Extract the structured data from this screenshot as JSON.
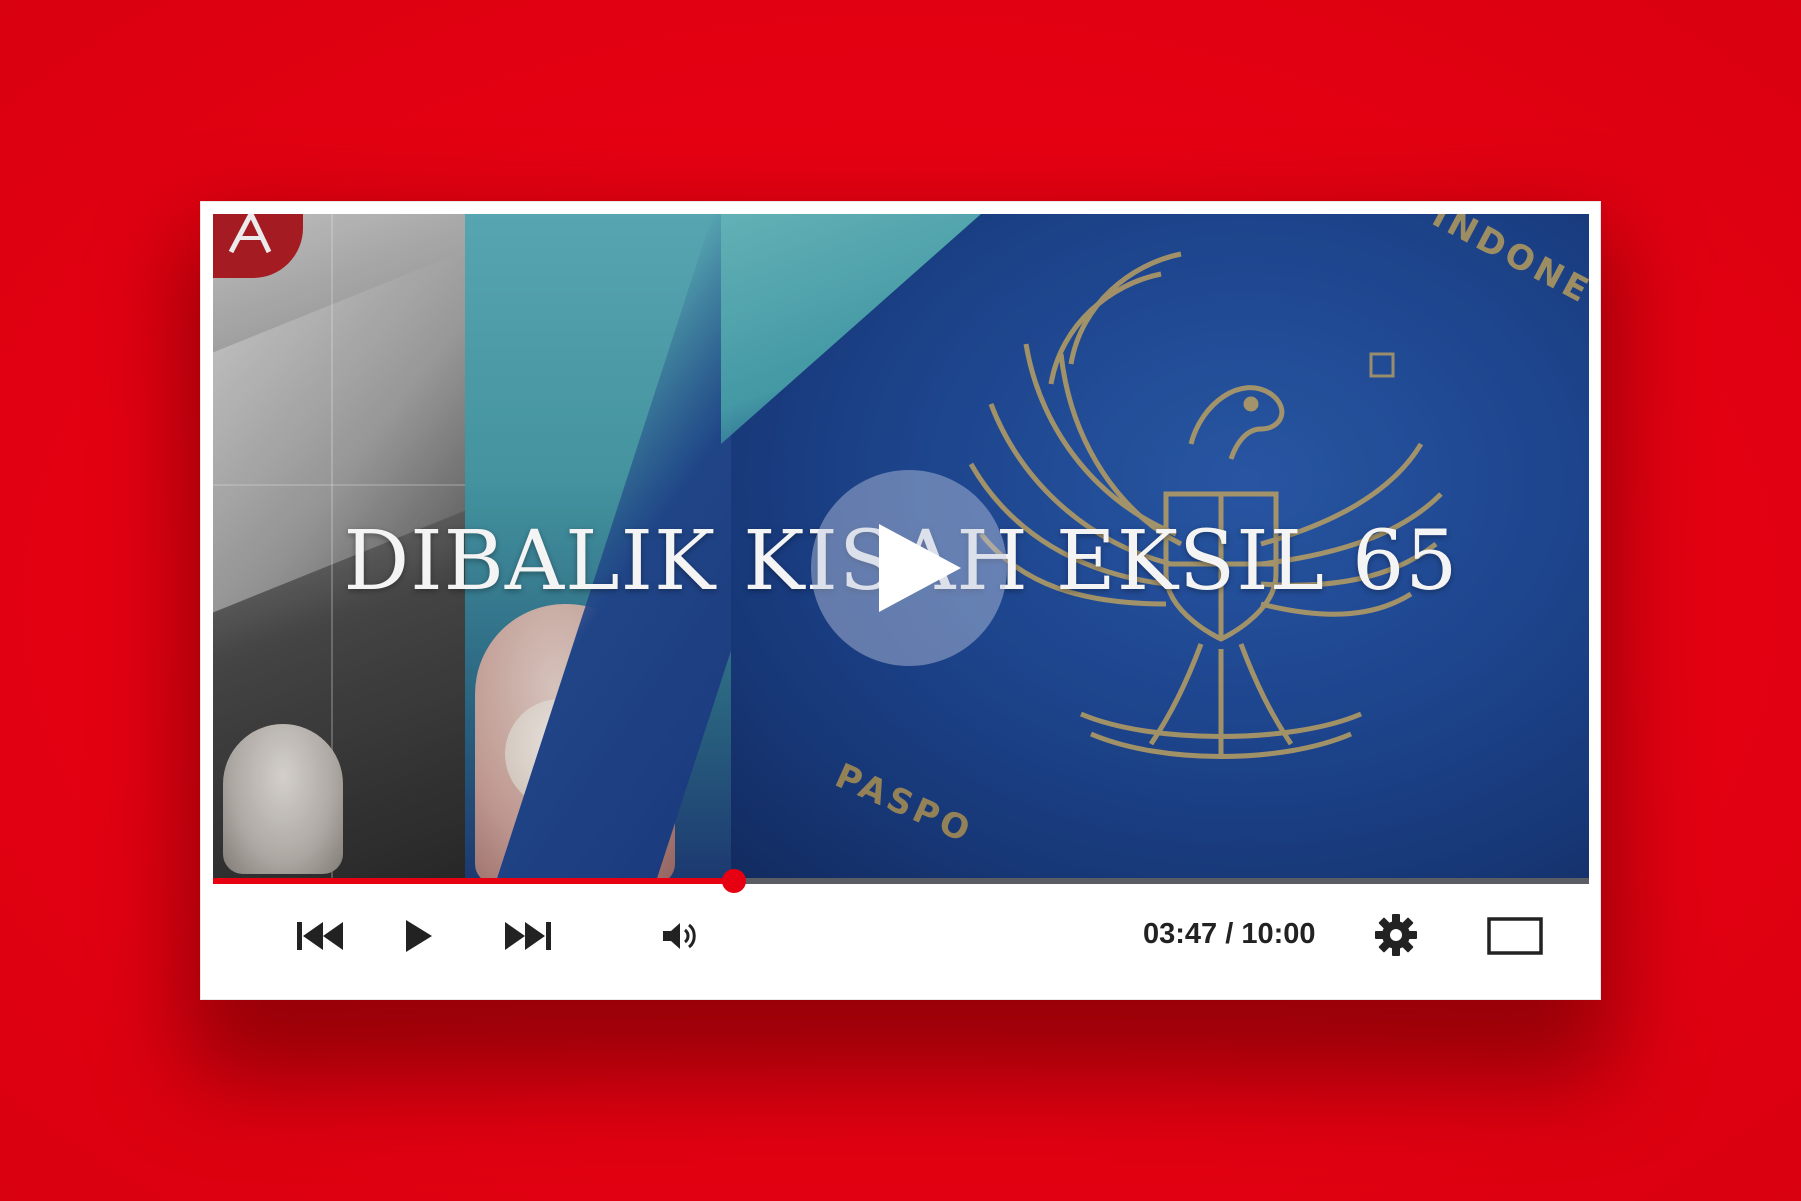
{
  "video": {
    "title": "DIBALIK KISAH EKSIL 65",
    "cover_country_text": "INDONE",
    "cover_passport_text": "PASPO",
    "logo_letter": "A"
  },
  "playback": {
    "current_time": "03:47",
    "duration": "10:00",
    "time_display": "03:47 / 10:00",
    "progress_fraction": 0.3783
  },
  "controls": {
    "previous_icon": "skip-previous-icon",
    "play_icon": "play-icon",
    "next_icon": "skip-next-icon",
    "volume_icon": "volume-icon",
    "settings_icon": "gear-icon",
    "fullscreen_icon": "fullscreen-icon"
  },
  "colors": {
    "background": "#e60012",
    "accent": "#e60012",
    "progress_track": "#5a5d63",
    "control_icons": "#222222"
  }
}
